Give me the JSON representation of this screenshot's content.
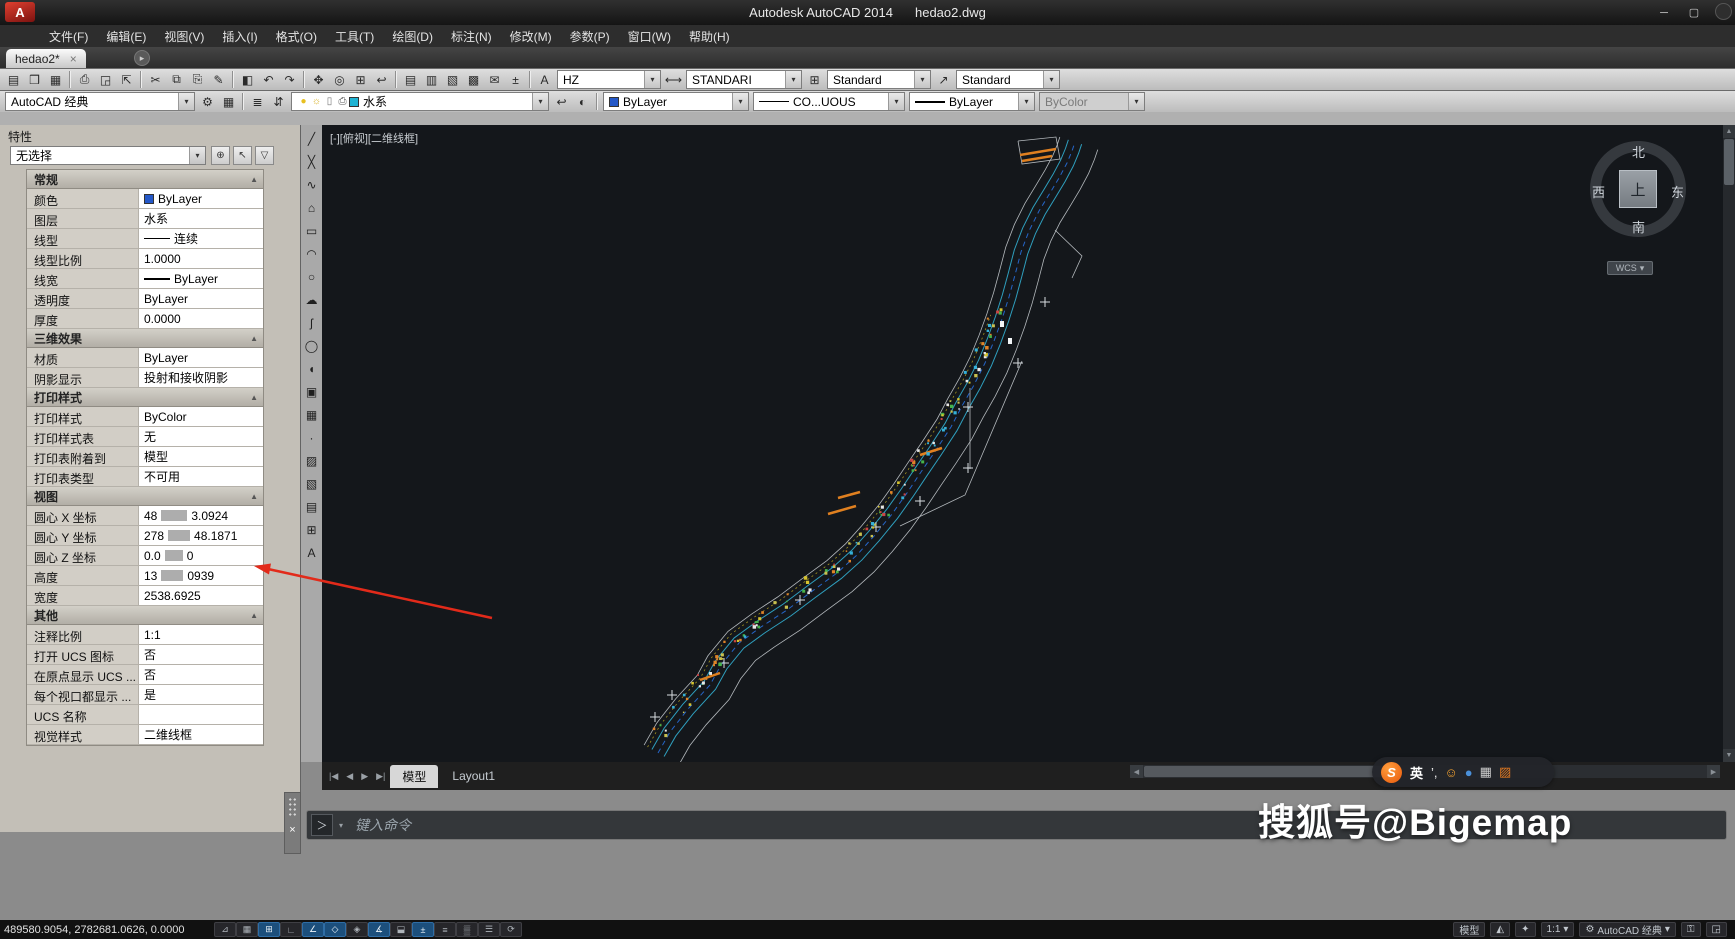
{
  "colors": {
    "canvas_bg": "#14171b",
    "accent_cyan": "#2f9fbe",
    "bylayer_swatch": "#2458c8",
    "layer_swatch": "#1fb4d4",
    "arrow_red": "#e22a1a",
    "sogou_orange": "#e8590c"
  },
  "title_bar": {
    "app_title": "Autodesk AutoCAD 2014",
    "doc_title": "hedao2.dwg",
    "logo": "A",
    "window_controls": [
      {
        "name": "minimize-button",
        "glyph": "─"
      },
      {
        "name": "maximize-button",
        "glyph": "▢"
      }
    ]
  },
  "menu": {
    "items": [
      "文件(F)",
      "编辑(E)",
      "视图(V)",
      "插入(I)",
      "格式(O)",
      "工具(T)",
      "绘图(D)",
      "标注(N)",
      "修改(M)",
      "参数(P)",
      "窗口(W)",
      "帮助(H)"
    ]
  },
  "file_tabs": {
    "active_tab": "hedao2*"
  },
  "toolbars": {
    "standard_icons": [
      {
        "name": "qnew-icon",
        "glyph": "▤"
      },
      {
        "name": "open-icon",
        "glyph": "❒"
      },
      {
        "name": "save-icon",
        "glyph": "▦"
      },
      {
        "sep": true
      },
      {
        "name": "plot-icon",
        "glyph": "⎙"
      },
      {
        "name": "plot-preview-icon",
        "glyph": "◲"
      },
      {
        "name": "publish-icon",
        "glyph": "⇱"
      },
      {
        "sep": true
      },
      {
        "name": "cut-icon",
        "glyph": "✂"
      },
      {
        "name": "copy-icon",
        "glyph": "⧉"
      },
      {
        "name": "paste-icon",
        "glyph": "⎘"
      },
      {
        "name": "match-properties-icon",
        "glyph": "✎"
      },
      {
        "sep": true
      },
      {
        "name": "block-editor-icon",
        "glyph": "◧"
      },
      {
        "name": "undo-icon",
        "glyph": "↶"
      },
      {
        "name": "redo-icon",
        "glyph": "↷"
      },
      {
        "sep": true
      },
      {
        "name": "pan-icon",
        "glyph": "✥"
      },
      {
        "name": "zoom-realtime-icon",
        "glyph": "◎"
      },
      {
        "name": "zoom-window-icon",
        "glyph": "⊞"
      },
      {
        "name": "zoom-previous-icon",
        "glyph": "↩"
      },
      {
        "sep": true
      },
      {
        "name": "properties-icon",
        "glyph": "▤"
      },
      {
        "name": "designcenter-icon",
        "glyph": "▥"
      },
      {
        "name": "tool-palettes-icon",
        "glyph": "▧"
      },
      {
        "name": "sheet-set-manager-icon",
        "glyph": "▩"
      },
      {
        "name": "markup-set-manager-icon",
        "glyph": "✉"
      },
      {
        "name": "quickcalc-icon",
        "glyph": "±"
      },
      {
        "sep": true
      }
    ],
    "style_icons": [
      {
        "name": "text-style-icon",
        "glyph": "A"
      },
      {
        "name": "dim-style-icon",
        "glyph": "⟷"
      },
      {
        "name": "table-style-icon",
        "glyph": "⊞"
      },
      {
        "name": "mleader-style-icon",
        "glyph": "↗"
      }
    ],
    "styles": {
      "text_style": "HZ",
      "dim_style": "STANDARI",
      "table_style": "Standard",
      "mleader_style": "Standard"
    },
    "workspace": "AutoCAD 经典",
    "workspace_icons": [
      {
        "name": "workspace-settings-gear-icon",
        "glyph": "⚙"
      },
      {
        "name": "workspace-save-icon",
        "glyph": "▦"
      }
    ],
    "layer_mgr_icons": [
      {
        "name": "layer-properties-manager-icon",
        "glyph": "≣"
      },
      {
        "name": "layer-states-icon",
        "glyph": "⇵"
      }
    ],
    "layer": {
      "icons": [
        {
          "name": "layer-on-icon",
          "glyph": "●",
          "color": "#e8c020"
        },
        {
          "name": "layer-freeze-icon",
          "glyph": "☼",
          "color": "#d8b020"
        },
        {
          "name": "layer-lock-icon",
          "glyph": "▯",
          "color": "#777777"
        },
        {
          "name": "layer-plot-icon",
          "glyph": "⎙",
          "color": "#555555"
        },
        {
          "name": "layer-color-swatch",
          "swatch": "#1fb4d4"
        }
      ],
      "name": "水系"
    },
    "layer_after_icons": [
      {
        "name": "layer-previous-icon",
        "glyph": "↩"
      },
      {
        "name": "layer-isolate-icon",
        "glyph": "◐"
      }
    ],
    "color": "ByLayer",
    "linetype": "CO...UOUS",
    "lineweight": "ByLayer",
    "plotstyle": "ByColor"
  },
  "properties_panel": {
    "title": "特性",
    "selection": "无选择",
    "buttons": [
      {
        "name": "pickadd-toggle-icon",
        "glyph": "⊕"
      },
      {
        "name": "select-objects-icon",
        "glyph": "↖"
      },
      {
        "name": "quick-select-icon",
        "glyph": "▽"
      }
    ],
    "sections": [
      {
        "title": "常规",
        "rows": [
          {
            "label": "颜色",
            "value": "ByLayer",
            "pre": "swatch"
          },
          {
            "label": "图层",
            "value": "水系"
          },
          {
            "label": "线型",
            "value": "连续",
            "pre": "line"
          },
          {
            "label": "线型比例",
            "value": "1.0000"
          },
          {
            "label": "线宽",
            "value": "ByLayer",
            "pre": "lineweight"
          },
          {
            "label": "透明度",
            "value": "ByLayer"
          },
          {
            "label": "厚度",
            "value": "0.0000"
          }
        ]
      },
      {
        "title": "三维效果",
        "rows": [
          {
            "label": "材质",
            "value": "ByLayer"
          },
          {
            "label": "阴影显示",
            "value": "投射和接收阴影"
          }
        ]
      },
      {
        "title": "打印样式",
        "rows": [
          {
            "label": "打印样式",
            "value": "ByColor"
          },
          {
            "label": "打印样式表",
            "value": "无"
          },
          {
            "label": "打印表附着到",
            "value": "模型"
          },
          {
            "label": "打印表类型",
            "value": "不可用"
          }
        ]
      },
      {
        "title": "视图",
        "rows": [
          {
            "label": "圆心 X 坐标",
            "masked": true,
            "value_pre": "48",
            "value_post": "3.0924",
            "mask_w": 26
          },
          {
            "label": "圆心 Y 坐标",
            "masked": true,
            "value_pre": "278",
            "value_post": "48.1871",
            "mask_w": 22
          },
          {
            "label": "圆心 Z 坐标",
            "masked": true,
            "value_pre": "0.0",
            "value_post": "0",
            "mask_w": 18
          },
          {
            "label": "高度",
            "masked": true,
            "value_pre": "13",
            "value_post": "0939",
            "mask_w": 22
          },
          {
            "label": "宽度",
            "value": "2538.6925"
          }
        ]
      },
      {
        "title": "其他",
        "rows": [
          {
            "label": "注释比例",
            "value": "1:1"
          },
          {
            "label": "打开 UCS 图标",
            "value": "否"
          },
          {
            "label": "在原点显示 UCS ...",
            "value": "否"
          },
          {
            "label": "每个视口都显示 ...",
            "value": "是"
          },
          {
            "label": "UCS 名称",
            "value": ""
          },
          {
            "label": "视觉样式",
            "value": "二维线框"
          }
        ]
      }
    ]
  },
  "draw_toolbar": {
    "tools": [
      {
        "name": "line-tool",
        "glyph": "╱"
      },
      {
        "name": "construction-line-tool",
        "glyph": "╳"
      },
      {
        "name": "polyline-tool",
        "glyph": "∿"
      },
      {
        "name": "polygon-tool",
        "glyph": "⌂"
      },
      {
        "name": "rectangle-tool",
        "glyph": "▭"
      },
      {
        "name": "arc-tool",
        "glyph": "◠"
      },
      {
        "name": "circle-tool",
        "glyph": "○"
      },
      {
        "name": "revcloud-tool",
        "glyph": "☁"
      },
      {
        "name": "spline-tool",
        "glyph": "ʃ"
      },
      {
        "name": "ellipse-tool",
        "glyph": "◯"
      },
      {
        "name": "ellipse-arc-tool",
        "glyph": "◖"
      },
      {
        "name": "insert-block-tool",
        "glyph": "▣"
      },
      {
        "name": "make-block-tool",
        "glyph": "▦"
      },
      {
        "name": "point-tool",
        "glyph": "·"
      },
      {
        "name": "hatch-tool",
        "glyph": "▨"
      },
      {
        "name": "gradient-tool",
        "glyph": "▧"
      },
      {
        "name": "region-tool",
        "glyph": "▤"
      },
      {
        "name": "table-tool",
        "glyph": "⊞"
      },
      {
        "name": "mtext-tool",
        "glyph": "A"
      }
    ]
  },
  "viewport": {
    "label": "[-][俯视][二维线框]",
    "compass": {
      "north": "北",
      "south": "南",
      "west": "西",
      "east": "东",
      "center": "上",
      "wcs": "WCS"
    }
  },
  "layout_tabs": {
    "nav": [
      "|◀",
      "◀",
      "▶",
      "▶|"
    ],
    "model": "模型",
    "layout1": "Layout1"
  },
  "command_line": {
    "prompt": "＞",
    "placeholder": "键入命令"
  },
  "status_bar": {
    "coordinates": "489580.9054, 2782681.0626, 0.0000",
    "toggles": [
      {
        "name": "infer-constraints-toggle",
        "glyph": "⊿",
        "on": false
      },
      {
        "name": "snap-toggle",
        "glyph": "▦",
        "on": false
      },
      {
        "name": "grid-toggle",
        "glyph": "⊞",
        "on": true
      },
      {
        "name": "ortho-toggle",
        "glyph": "∟",
        "on": false
      },
      {
        "name": "polar-toggle",
        "glyph": "∠",
        "on": true
      },
      {
        "name": "osnap-toggle",
        "glyph": "◇",
        "on": true
      },
      {
        "name": "osnap3d-toggle",
        "glyph": "◈",
        "on": false
      },
      {
        "name": "otrack-toggle",
        "glyph": "∡",
        "on": true
      },
      {
        "name": "ducs-toggle",
        "glyph": "⬓",
        "on": false
      },
      {
        "name": "dyn-toggle",
        "glyph": "±",
        "on": true
      },
      {
        "name": "lineweight-toggle",
        "glyph": "≡",
        "on": false
      },
      {
        "name": "transparency-toggle",
        "glyph": "▒",
        "on": false
      },
      {
        "name": "quick-properties-toggle",
        "glyph": "☰",
        "on": false
      },
      {
        "name": "selection-cycling-toggle",
        "glyph": "⟳",
        "on": false
      }
    ],
    "right": {
      "model": "模型",
      "scale": "1:1",
      "workspace": "AutoCAD 经典"
    },
    "right_icons": [
      {
        "name": "annotation-visibility-icon",
        "glyph": "◭"
      },
      {
        "name": "annotation-autoscale-icon",
        "glyph": "✦"
      },
      {
        "name": "workspace-gear-icon",
        "glyph": "⚙"
      },
      {
        "name": "lock-ui-icon",
        "glyph": "⚿"
      },
      {
        "name": "clean-screen-icon",
        "glyph": "◲"
      }
    ]
  },
  "overlays": {
    "watermark": "搜狐号@Bigemap",
    "ime": {
      "logo": "S",
      "lang": "英",
      "icons": [
        {
          "name": "ime-punctuation-icon",
          "glyph": "’,",
          "color": "#e8e8e8"
        },
        {
          "name": "ime-emoji-icon",
          "glyph": "☺",
          "color": "#f0a030"
        },
        {
          "name": "ime-mic-icon",
          "glyph": "●",
          "color": "#4a90d9"
        },
        {
          "name": "ime-keyboard-icon",
          "glyph": "▦",
          "color": "#cccccc"
        },
        {
          "name": "ime-toolbox-icon",
          "glyph": "▨",
          "color": "#e07820"
        }
      ]
    }
  }
}
